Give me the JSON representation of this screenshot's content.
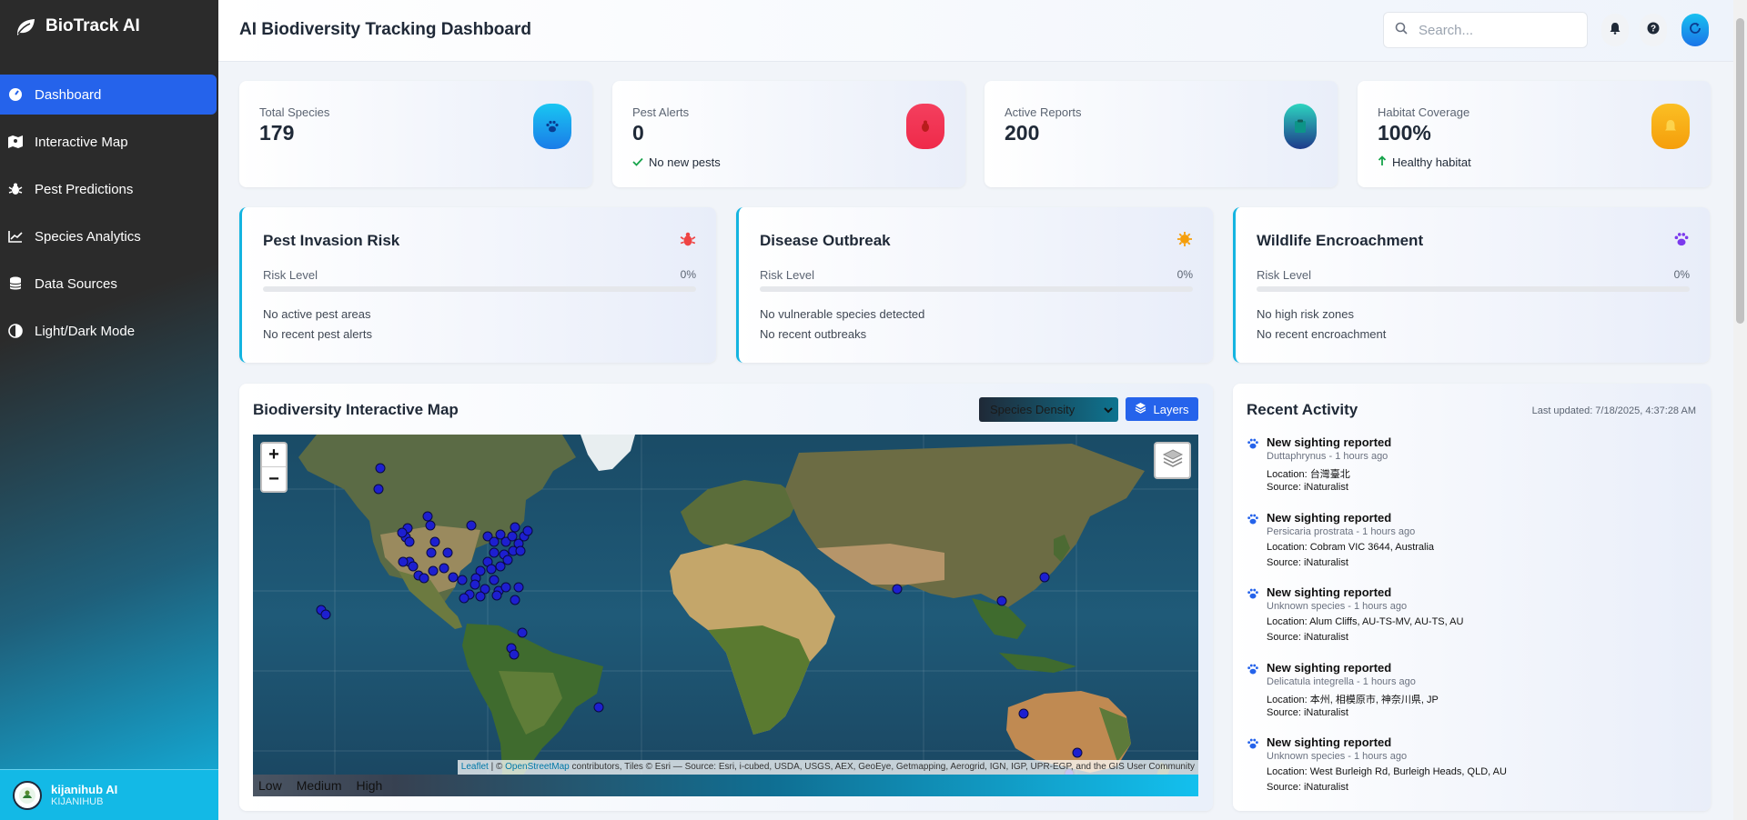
{
  "sidebar": {
    "brand": "BioTrack AI",
    "items": [
      {
        "label": "Dashboard",
        "icon": "gauge-icon"
      },
      {
        "label": "Interactive Map",
        "icon": "map-icon"
      },
      {
        "label": "Pest Predictions",
        "icon": "bug-icon"
      },
      {
        "label": "Species Analytics",
        "icon": "chart-line-icon"
      },
      {
        "label": "Data Sources",
        "icon": "database-icon"
      },
      {
        "label": "Light/Dark Mode",
        "icon": "contrast-icon"
      }
    ],
    "active_index": 0,
    "user": {
      "name": "kijanihub AI",
      "org": "KIJANIHUB"
    }
  },
  "header": {
    "title": "AI Biodiversity Tracking Dashboard",
    "search_placeholder": "Search..."
  },
  "stats": [
    {
      "label": "Total Species",
      "value": "179",
      "sub": "",
      "icon": "paw-icon",
      "color": "#1e9bf0"
    },
    {
      "label": "Pest Alerts",
      "value": "0",
      "sub": "No new pests",
      "icon": "bug-icon",
      "color": "#ef4444"
    },
    {
      "label": "Active Reports",
      "value": "200",
      "sub": "",
      "icon": "clipboard-icon",
      "color": "#14b8a6"
    },
    {
      "label": "Habitat Coverage",
      "value": "100%",
      "sub": "Healthy habitat",
      "icon": "bell-icon",
      "color": "#f59e0b"
    }
  ],
  "risks": [
    {
      "title": "Pest Invasion Risk",
      "risk_label": "Risk Level",
      "percent": "0%",
      "line1": "No active pest areas",
      "line2": "No recent pest alerts",
      "icon": "bug-icon",
      "color": "#ef4444"
    },
    {
      "title": "Disease Outbreak",
      "risk_label": "Risk Level",
      "percent": "0%",
      "line1": "No vulnerable species detected",
      "line2": "No recent outbreaks",
      "icon": "virus-icon",
      "color": "#f59e0b"
    },
    {
      "title": "Wildlife Encroachment",
      "risk_label": "Risk Level",
      "percent": "0%",
      "line1": "No high risk zones",
      "line2": "No recent encroachment",
      "icon": "paw-icon",
      "color": "#7c3aed"
    }
  ],
  "map": {
    "title": "Biodiversity Interactive Map",
    "select_value": "Species Density",
    "layers_label": "Layers",
    "zoom_in": "+",
    "zoom_out": "−",
    "attribution_leaflet": "Leaflet",
    "attribution_sep": " | © ",
    "attribution_osm": "OpenStreetMap",
    "attribution_rest": " contributors, Tiles © Esri — Source: Esri, i-cubed, USDA, USGS, AEX, GeoEye, Getmapping, Aerogrid, IGN, IGP, UPR-EGP, and the GIS User Community",
    "legend": [
      "Low",
      "Medium",
      "High"
    ]
  },
  "activity": {
    "title": "Recent Activity",
    "updated": "Last updated: 7/18/2025, 4:37:28 AM",
    "items": [
      {
        "heading": "New sighting reported",
        "meta": "Duttaphrynus - 1 hours ago",
        "location": "Location: 台灣臺北",
        "source": "Source: iNaturalist"
      },
      {
        "heading": "New sighting reported",
        "meta": "Persicaria prostrata - 1 hours ago",
        "location": "Location: Cobram VIC 3644, Australia",
        "source": "Source: iNaturalist"
      },
      {
        "heading": "New sighting reported",
        "meta": "Unknown species - 1 hours ago",
        "location": "Location: Alum Cliffs, AU-TS-MV, AU-TS, AU",
        "source": "Source: iNaturalist"
      },
      {
        "heading": "New sighting reported",
        "meta": "Delicatula integrella - 1 hours ago",
        "location": "Location: 本州, 相模原市, 神奈川県, JP",
        "source": "Source: iNaturalist"
      },
      {
        "heading": "New sighting reported",
        "meta": "Unknown species - 1 hours ago",
        "location": "Location: West Burleigh Rd, Burleigh Heads, QLD, AU",
        "source": "Source: iNaturalist"
      }
    ]
  },
  "colors": {
    "accent": "#2563eb",
    "marker": "#1d1fd0"
  }
}
